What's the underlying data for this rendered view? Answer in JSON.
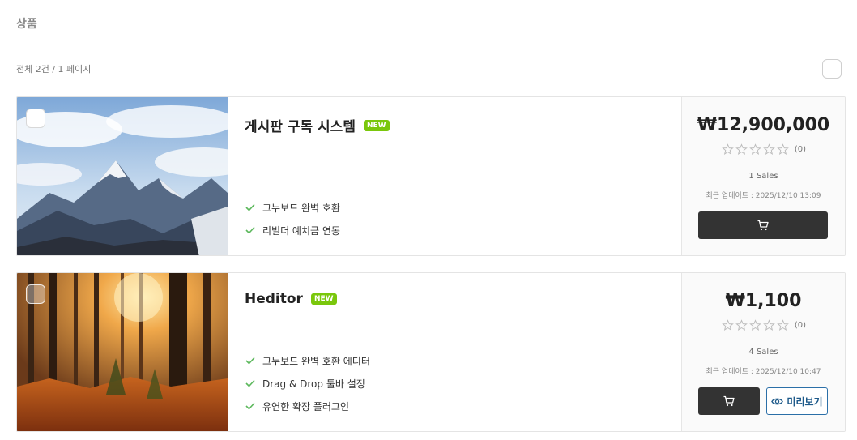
{
  "header": {
    "title": "상품",
    "count_text": "전체 2건 / 1 페이지"
  },
  "products": [
    {
      "name": "게시판 구독 시스템",
      "badge": "NEW",
      "features": [
        "그누보드 완벽 호환",
        "리빌더 예치금 연동"
      ],
      "price": "₩12,900,000",
      "rating": 0,
      "rating_count": "(0)",
      "sales": "1 Sales",
      "updated": "최근 업데이트 : 2025/12/10 13:09",
      "thumbnail": "snowy mountain landscape"
    },
    {
      "name": "Heditor",
      "badge": "NEW",
      "features": [
        "그누보드 완벽 호환 에디터",
        "Drag & Drop 툴바 설정",
        "유연한 확장 플러그인"
      ],
      "price": "₩1,100",
      "rating": 0,
      "rating_count": "(0)",
      "sales": "4 Sales",
      "updated": "최근 업데이트 : 2025/12/10 10:47",
      "preview_label": "미리보기",
      "thumbnail": "autumn forest with sunlight"
    }
  ],
  "colors": {
    "badge": "#7ac70c",
    "check": "#5cb85c",
    "cart_button": "#333333",
    "preview_border": "#2b6fa8"
  }
}
